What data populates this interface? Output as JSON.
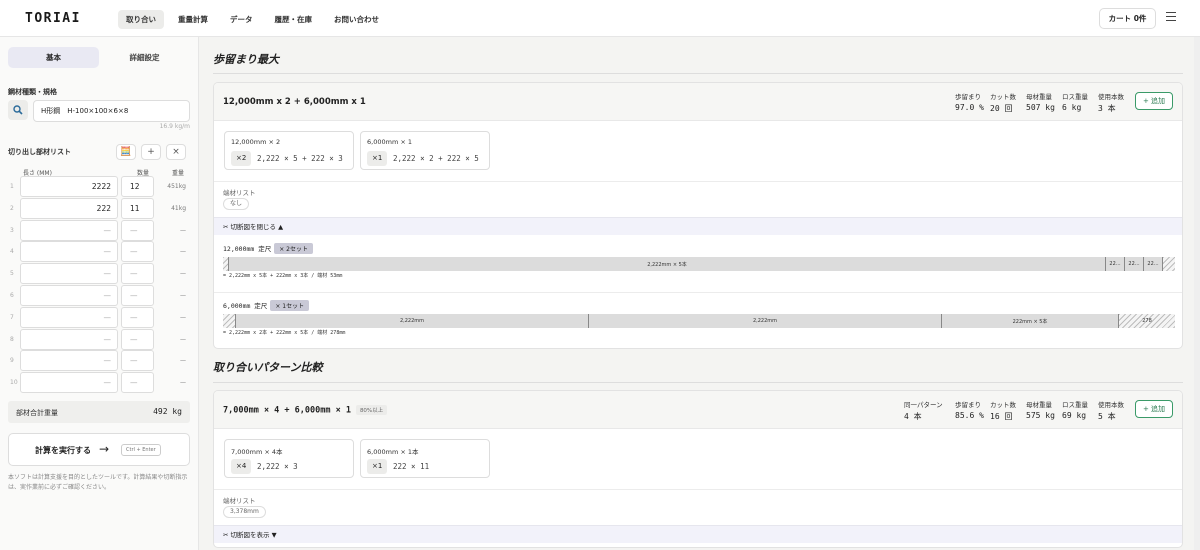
{
  "app": {
    "logo": "TORIAI"
  },
  "nav": [
    "取り合い",
    "重量計算",
    "データ",
    "履歴・在庫",
    "お問い合わせ"
  ],
  "cart": "カート 0件",
  "sidebar": {
    "tabs": [
      "基本",
      "詳細設定"
    ],
    "spec_label": "鋼材種類・規格",
    "spec_value": "H形鋼　H-100×100×6×8",
    "unit_weight": "16.9 kg/m",
    "list_label": "切り出し部材リスト",
    "headers": {
      "length": "長さ (MM)",
      "qty": "数量",
      "weight": "重量"
    },
    "rows": [
      {
        "n": "1",
        "length": "2222",
        "qty": "12",
        "weight": "451kg"
      },
      {
        "n": "2",
        "length": "222",
        "qty": "11",
        "weight": "41kg"
      },
      {
        "n": "3",
        "length": "—",
        "qty": "—",
        "weight": "—"
      },
      {
        "n": "4",
        "length": "—",
        "qty": "—",
        "weight": "—"
      },
      {
        "n": "5",
        "length": "—",
        "qty": "—",
        "weight": "—"
      },
      {
        "n": "6",
        "length": "—",
        "qty": "—",
        "weight": "—"
      },
      {
        "n": "7",
        "length": "—",
        "qty": "—",
        "weight": "—"
      },
      {
        "n": "8",
        "length": "—",
        "qty": "—",
        "weight": "—"
      },
      {
        "n": "9",
        "length": "—",
        "qty": "—",
        "weight": "—"
      },
      {
        "n": "10",
        "length": "—",
        "qty": "—",
        "weight": "—"
      }
    ],
    "total_label": "部材合計重量",
    "total_value": "492 kg",
    "run_label": "計算を実行する",
    "run_kbd": "Ctrl + Enter",
    "note": "本ソフトは計算支援を目的としたツールです。計算結果や切断指示は、実作業前に必ずご確認ください。"
  },
  "main": {
    "section1_title": "歩留まり最大",
    "section2_title": "取り合いパターン比較",
    "add_label": "+ 追加",
    "remnant_label": "端材リスト",
    "card1": {
      "title": "12,000mm x 2 + 6,000mm x 1",
      "stats": [
        {
          "k": "歩留まり",
          "v": "97.0 %"
        },
        {
          "k": "カット数",
          "v": "20 回"
        },
        {
          "k": "母材重量",
          "v": "507 kg"
        },
        {
          "k": "ロス重量",
          "v": "6 kg"
        },
        {
          "k": "使用本数",
          "v": "3 本"
        }
      ],
      "patterns": [
        {
          "title": "12,000mm × 2",
          "chip": "×2",
          "expr": "2,222 × 5 + 222 × 3"
        },
        {
          "title": "6,000mm × 1",
          "chip": "×1",
          "expr": "2,222 × 2 + 222 × 5"
        }
      ],
      "remnant": "なし",
      "toggle": "✂ 切断図を閉じる ▲",
      "bar1": {
        "label": "12,000mm 定尺",
        "tag": "× 2セット",
        "segments": [
          "2,222mm × 5本",
          "22...",
          "22...",
          "22..."
        ],
        "sub": "= 2,222mm x 5本 + 222mm x 3本 / 端材 53mm"
      },
      "bar2": {
        "label": "6,000mm 定尺",
        "tag": "× 1セット",
        "segments": [
          "2,222mm",
          "2,222mm",
          "222mm × 5本",
          "278"
        ],
        "sub": "= 2,222mm x 2本 + 222mm x 5本 / 端材 278mm"
      }
    },
    "card2": {
      "title": "7,000mm × 4 + 6,000mm × 1",
      "tag": "80%以上",
      "stats": [
        {
          "k": "同一パターン",
          "v": "4 本"
        },
        {
          "k": "歩留まり",
          "v": "85.6 %"
        },
        {
          "k": "カット数",
          "v": "16 回"
        },
        {
          "k": "母材重量",
          "v": "575 kg"
        },
        {
          "k": "ロス重量",
          "v": "69 kg"
        },
        {
          "k": "使用本数",
          "v": "5 本"
        }
      ],
      "patterns": [
        {
          "title": "7,000mm × 4本",
          "chip": "×4",
          "expr": "2,222 × 3"
        },
        {
          "title": "6,000mm × 1本",
          "chip": "×1",
          "expr": "222 × 11"
        }
      ],
      "remnant": "3,378mm",
      "toggle": "✂ 切断図を表示 ▼"
    }
  }
}
